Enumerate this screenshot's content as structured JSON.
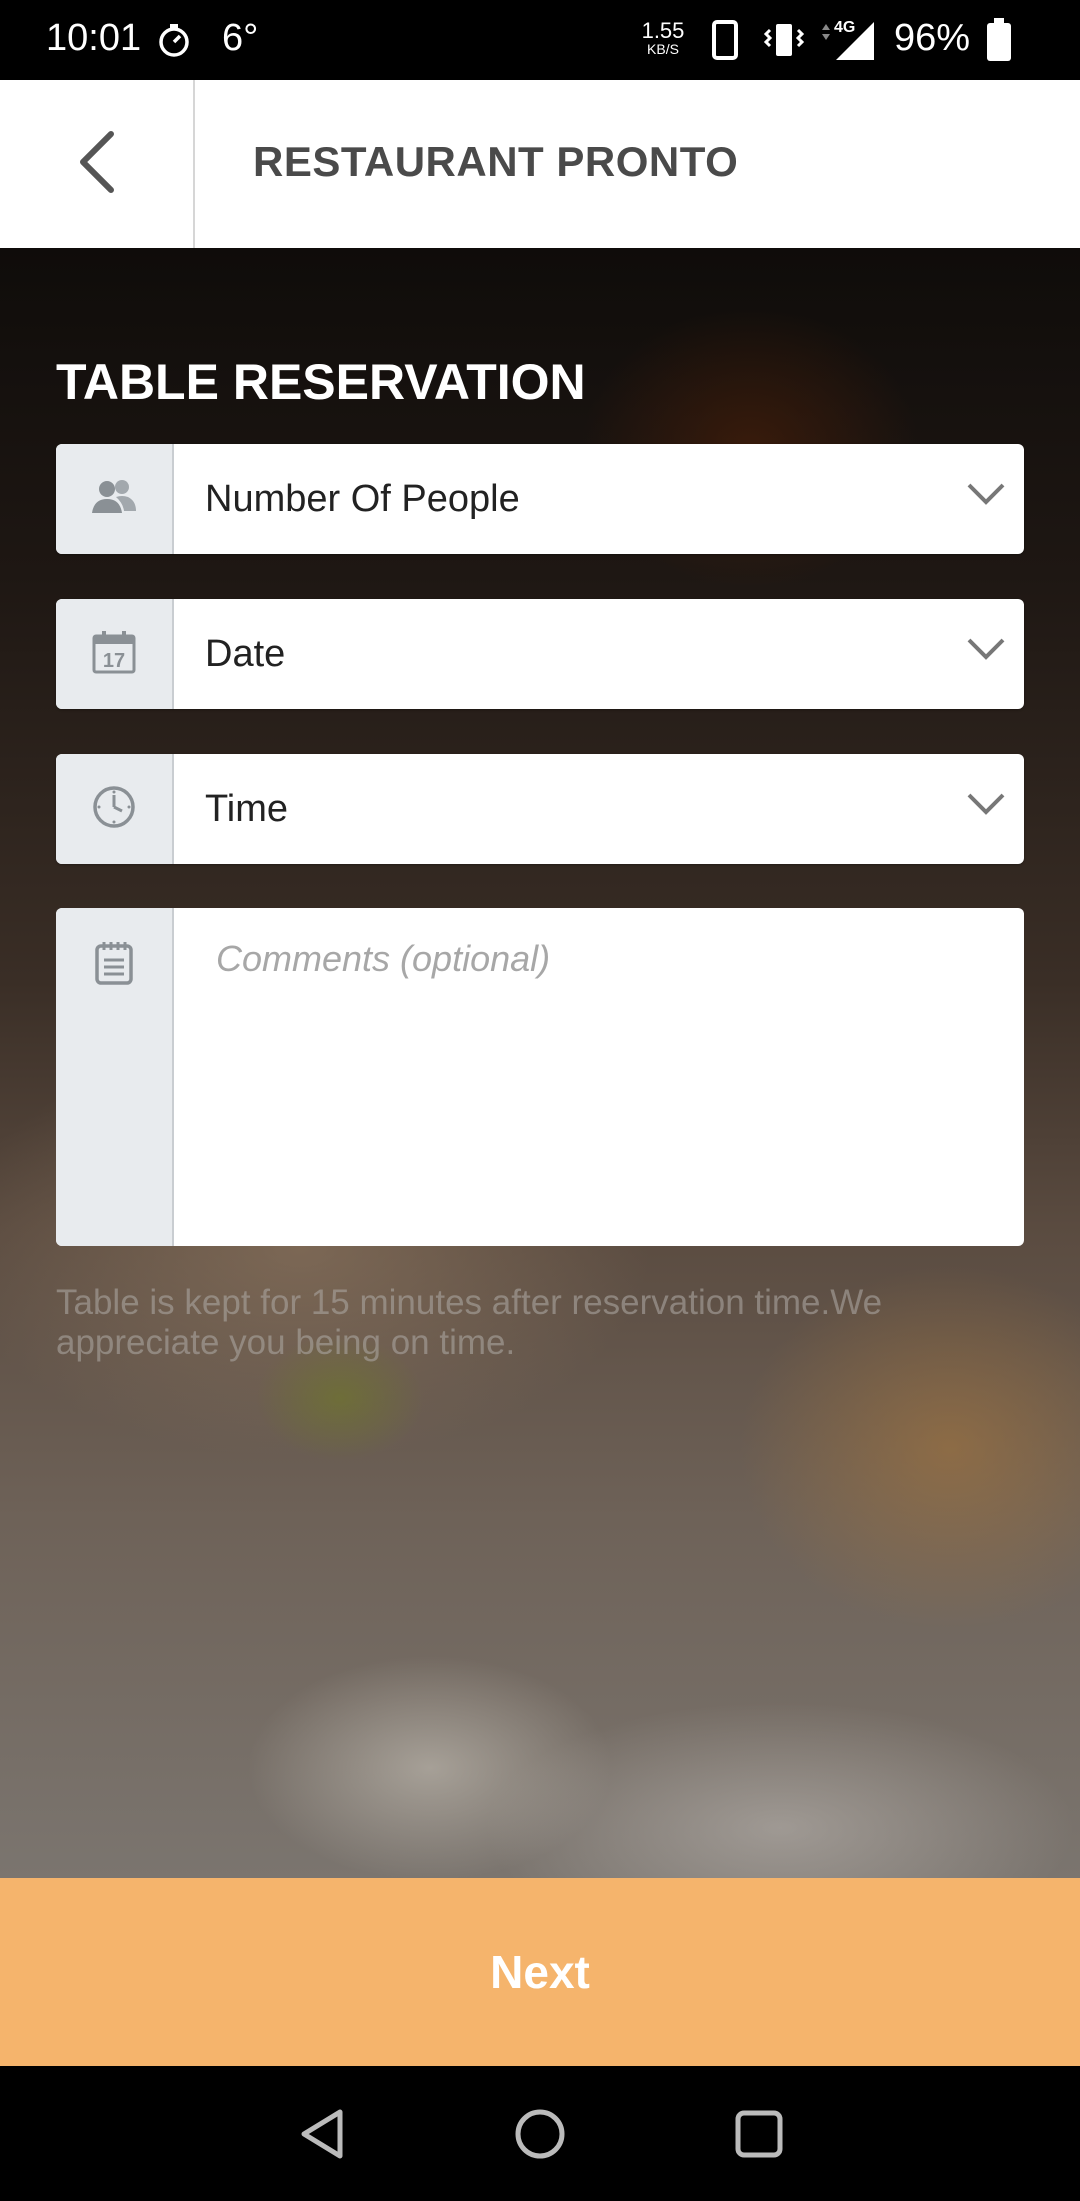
{
  "status_bar": {
    "time": "10:01",
    "temperature": "6°",
    "net_speed_value": "1.55",
    "net_speed_unit": "KB/S",
    "network_type": "4G",
    "battery_percent": "96%"
  },
  "app_bar": {
    "title": "RESTAURANT PRONTO",
    "back_icon": "chevron-left-icon"
  },
  "form": {
    "title": "TABLE RESERVATION",
    "people": {
      "label": "Number Of People",
      "icon": "people-icon"
    },
    "date": {
      "label": "Date",
      "icon": "calendar-icon",
      "calendar_day": "17"
    },
    "time": {
      "label": "Time",
      "icon": "clock-icon"
    },
    "comments": {
      "placeholder": "Comments (optional)",
      "value": "",
      "icon": "notepad-icon"
    },
    "note": "Table is kept for 15 minutes after reservation time.We appreciate you being on time."
  },
  "next_button": {
    "label": "Next"
  },
  "colors": {
    "accent": "#f5b46c",
    "icon_cell_bg": "#e8ebee",
    "title_text": "#4a4a4a"
  }
}
